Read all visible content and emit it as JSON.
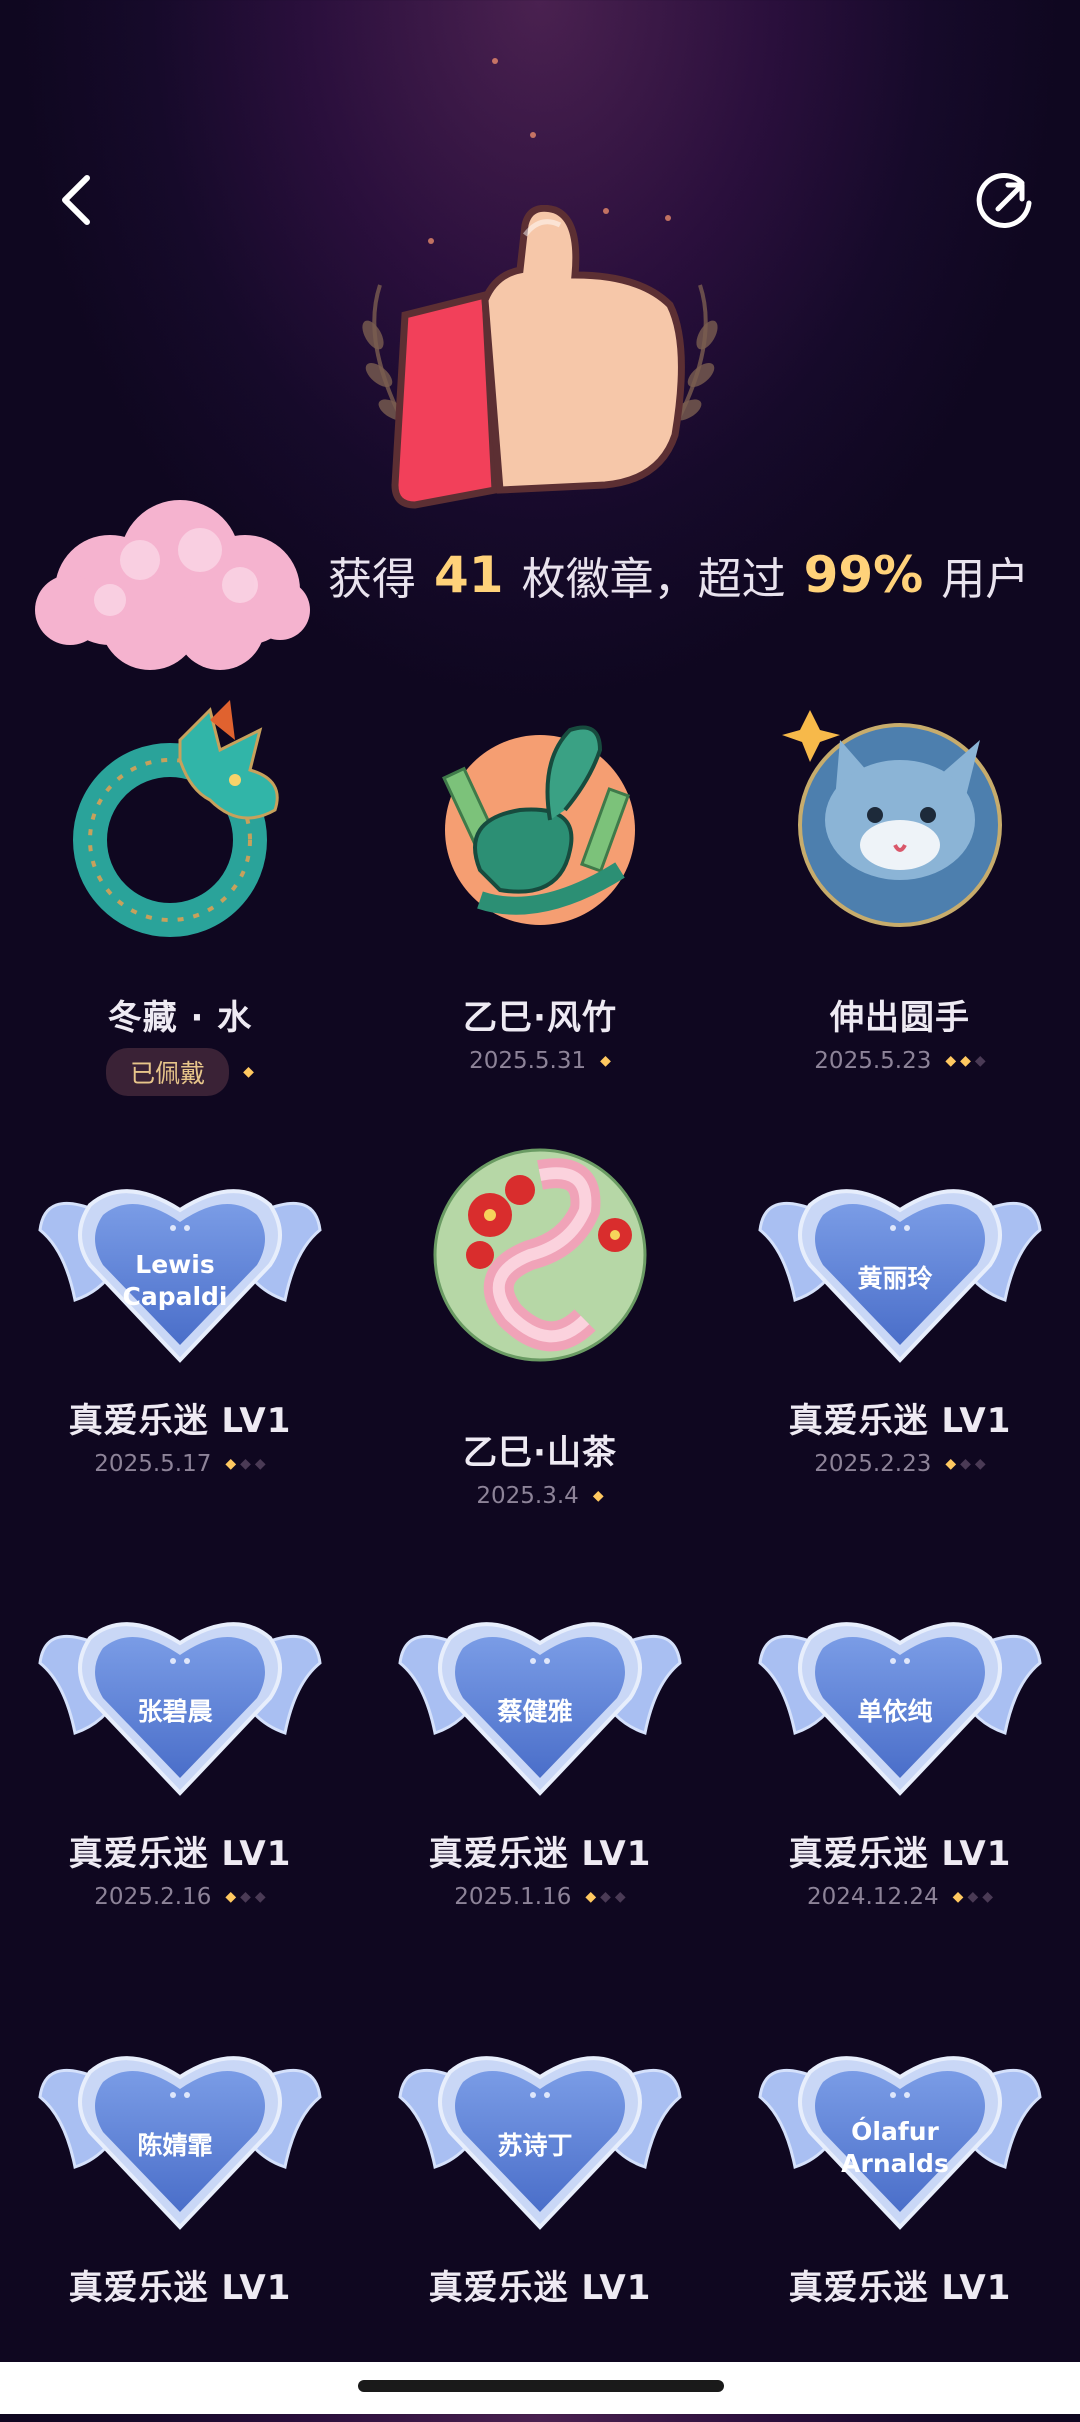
{
  "summary": {
    "prefix": "获得",
    "count": "41",
    "mid": "枚徽章，超过",
    "percent": "99%",
    "suffix": "用户"
  },
  "badges": [
    {
      "name": "冬藏 · 水",
      "date": "",
      "tag": "已佩戴",
      "stars": 1,
      "stars_total": 1,
      "type": "dragon"
    },
    {
      "name": "乙巳·风竹",
      "date": "2025.5.31",
      "stars": 1,
      "stars_total": 1,
      "type": "snake-bamboo"
    },
    {
      "name": "伸出圆手",
      "date": "2025.5.23",
      "stars": 2,
      "stars_total": 3,
      "type": "cat"
    },
    {
      "name": "真爱乐迷 LV1",
      "date": "2025.5.17",
      "stars": 1,
      "stars_total": 3,
      "type": "heart",
      "label": [
        "Lewis",
        "Capaldi"
      ]
    },
    {
      "name": "乙巳·山茶",
      "date": "2025.3.4",
      "stars": 1,
      "stars_total": 1,
      "type": "snake-camellia"
    },
    {
      "name": "真爱乐迷 LV1",
      "date": "2025.2.23",
      "stars": 1,
      "stars_total": 3,
      "type": "heart",
      "label": [
        "黄丽玲"
      ]
    },
    {
      "name": "真爱乐迷 LV1",
      "date": "2025.2.16",
      "stars": 1,
      "stars_total": 3,
      "type": "heart",
      "label": [
        "张碧晨"
      ]
    },
    {
      "name": "真爱乐迷 LV1",
      "date": "2025.1.16",
      "stars": 1,
      "stars_total": 3,
      "type": "heart",
      "label": [
        "蔡健雅"
      ]
    },
    {
      "name": "真爱乐迷 LV1",
      "date": "2024.12.24",
      "stars": 1,
      "stars_total": 3,
      "type": "heart",
      "label": [
        "单依纯"
      ]
    },
    {
      "name": "真爱乐迷 LV1",
      "date": "",
      "stars": 0,
      "stars_total": 0,
      "type": "heart",
      "label": [
        "陈婧霏"
      ]
    },
    {
      "name": "真爱乐迷 LV1",
      "date": "",
      "stars": 0,
      "stars_total": 0,
      "type": "heart",
      "label": [
        "苏诗丁"
      ]
    },
    {
      "name": "真爱乐迷 LV1",
      "date": "",
      "stars": 0,
      "stars_total": 0,
      "type": "heart",
      "label": [
        "Ólafur",
        "Arnalds"
      ]
    }
  ]
}
